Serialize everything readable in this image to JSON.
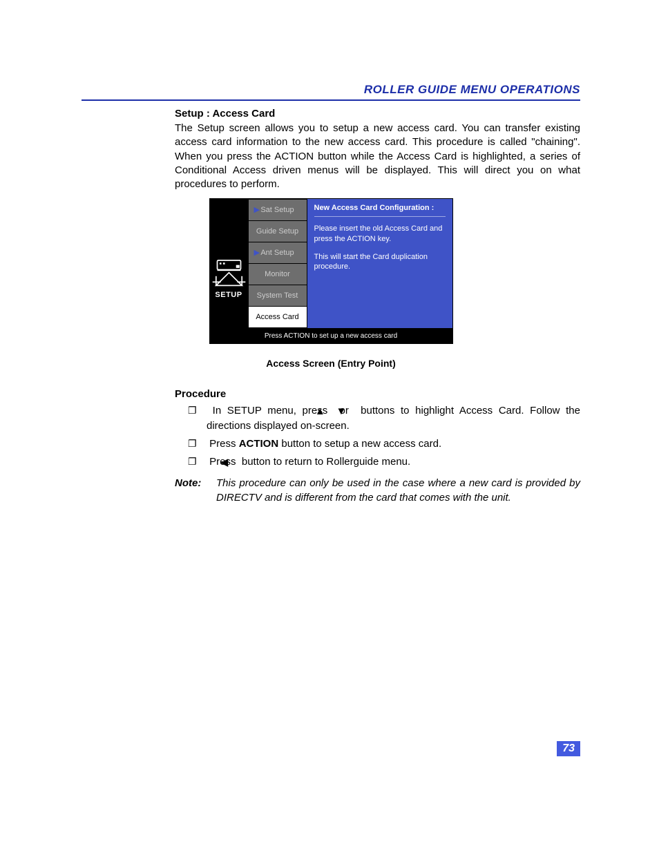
{
  "header": {
    "title": "ROLLER GUIDE MENU OPERATIONS"
  },
  "section": {
    "heading": "Setup : Access Card",
    "paragraph": "The Setup screen allows you to setup a new access card. You can transfer existing access card information to the new access card. This procedure is called \"chaining\". When you press the ACTION button while the Access Card is highlighted, a series of Conditional Access driven menus will be displayed. This will direct you on what procedures to perform."
  },
  "figure": {
    "setup_label": "SETUP",
    "menu": [
      {
        "label": "Sat Setup",
        "arrow": true,
        "selected": false
      },
      {
        "label": "Guide Setup",
        "arrow": false,
        "selected": false
      },
      {
        "label": "Ant Setup",
        "arrow": true,
        "selected": false
      },
      {
        "label": "Monitor",
        "arrow": false,
        "selected": false
      },
      {
        "label": "System Test",
        "arrow": false,
        "selected": false
      },
      {
        "label": "Access Card",
        "arrow": false,
        "selected": true
      }
    ],
    "detail": {
      "title": "New Access Card Configuration :",
      "line1": "Please insert the old Access Card and press the ACTION key.",
      "line2": "This will start the Card duplication procedure."
    },
    "hint": "Press ACTION to set up a new access card",
    "caption": "Access Screen (Entry Point)"
  },
  "procedure": {
    "heading": "Procedure",
    "step1_a": "In SETUP menu, press ",
    "step1_b": "   or ",
    "step1_c": "   buttons to highlight Access Card. Follow the directions displayed on-screen.",
    "step2_a": "Press ",
    "step2_b": "ACTION",
    "step2_c": " button to setup a new access card.",
    "step3_a": "Press  ",
    "step3_b": " button to return to Rollerguide menu."
  },
  "note": {
    "label": "Note:",
    "text": "This procedure can only be used in the case where a new card is provided by DIRECTV and is different from the card that comes with the unit."
  },
  "page_number": "73"
}
